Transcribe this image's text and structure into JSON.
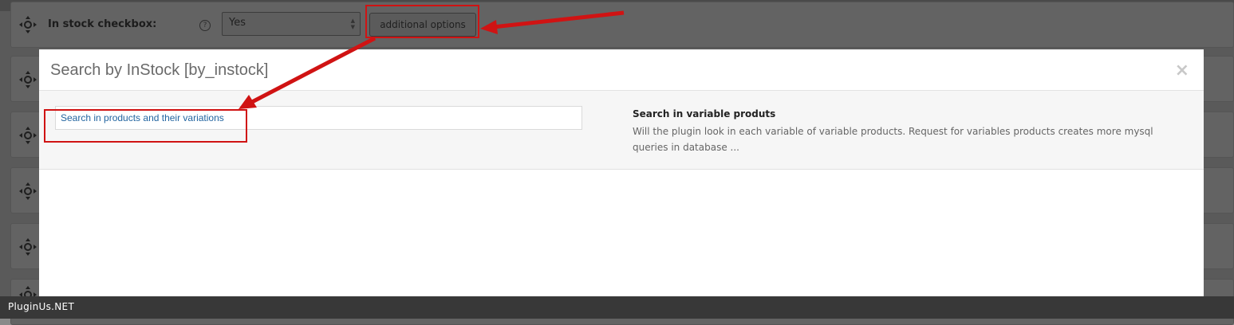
{
  "background_row": {
    "label": "In stock checkbox:",
    "help": "?",
    "select_value": "Yes",
    "additional_options_label": "additional options"
  },
  "modal": {
    "title": "Search by InStock [by_instock]",
    "close_symbol": "×",
    "option": {
      "input_value": "Search in products and their variations",
      "title": "Search in variable produts",
      "description": "Will the plugin look in each variable of variable products. Request for variables products creates more mysql queries in database ..."
    }
  },
  "footer": {
    "brand": "PluginUs.NET"
  },
  "colors": {
    "highlight": "#d01313",
    "link_blue": "#2365a0"
  },
  "icons": {
    "move": "move-arrows-icon",
    "help": "question-circle-icon",
    "close": "close-icon"
  }
}
